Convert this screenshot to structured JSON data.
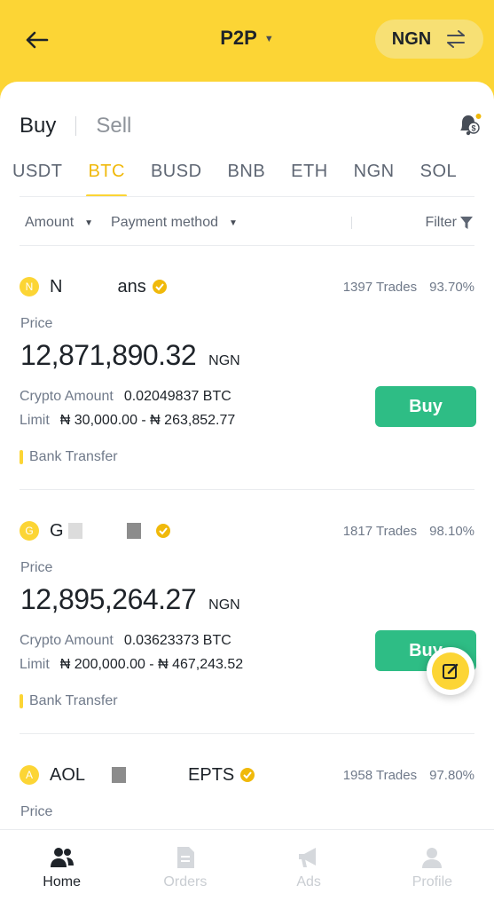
{
  "header": {
    "title": "P2P",
    "currency": "NGN",
    "back_icon": "arrow-left-icon",
    "swap_icon": "swap-icon"
  },
  "trade_type": {
    "buy": "Buy",
    "sell": "Sell",
    "active": "Buy"
  },
  "coins": [
    "USDT",
    "BTC",
    "BUSD",
    "BNB",
    "ETH",
    "NGN",
    "SOL"
  ],
  "active_coin": "BTC",
  "filters": {
    "amount": "Amount",
    "payment": "Payment method",
    "filter": "Filter"
  },
  "labels": {
    "price": "Price",
    "crypto_amount": "Crypto Amount",
    "limit": "Limit",
    "buy": "Buy",
    "fiat": "NGN"
  },
  "listings": [
    {
      "initial": "N",
      "merchant_start": "N",
      "merchant_end": "ans",
      "trades": "1397 Trades",
      "completion": "93.70%",
      "price": "12,871,890.32",
      "crypto_amount": "0.02049837 BTC",
      "limit": "₦ 30,000.00 - ₦ 263,852.77",
      "payment": "Bank Transfer"
    },
    {
      "initial": "G",
      "merchant_start": "G",
      "merchant_end": "",
      "trades": "1817 Trades",
      "completion": "98.10%",
      "price": "12,895,264.27",
      "crypto_amount": "0.03623373 BTC",
      "limit": "₦ 200,000.00 - ₦ 467,243.52",
      "payment": "Bank Transfer"
    },
    {
      "initial": "A",
      "merchant_start": "AOL",
      "merchant_end": "EPTS",
      "trades": "1958 Trades",
      "completion": "97.80%",
      "price": "",
      "crypto_amount": "",
      "limit": "",
      "payment": ""
    }
  ],
  "nav": [
    {
      "label": "Home",
      "icon": "users-icon",
      "active": true
    },
    {
      "label": "Orders",
      "icon": "document-icon",
      "active": false
    },
    {
      "label": "Ads",
      "icon": "megaphone-icon",
      "active": false
    },
    {
      "label": "Profile",
      "icon": "person-icon",
      "active": false
    }
  ],
  "colors": {
    "brand_yellow": "#fcd535",
    "buy_green": "#2ebd85",
    "active_tab": "#f0b90b"
  }
}
